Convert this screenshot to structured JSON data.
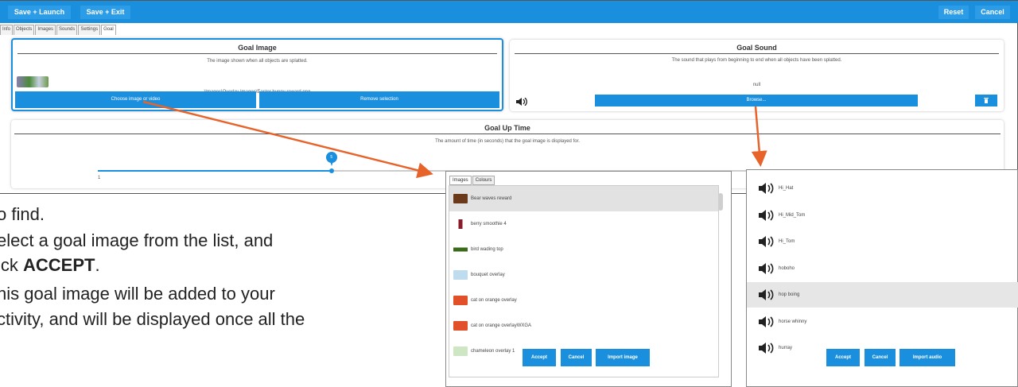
{
  "toolbar": {
    "save_launch": "Save + Launch",
    "save_exit": "Save + Exit",
    "reset": "Reset",
    "cancel": "Cancel"
  },
  "tabs": [
    "Info",
    "Objects",
    "Images",
    "Sounds",
    "Settings",
    "Goal"
  ],
  "goal_image": {
    "title": "Goal Image",
    "desc": "The image shown when all objects are splatted.",
    "path": "\\Images\\Overlay Images\\Easter bunny reward.png",
    "choose_btn": "Choose image or video",
    "remove_btn": "Remove selection"
  },
  "goal_sound": {
    "title": "Goal Sound",
    "desc": "The sound that plays from beginning to end when all objects have been splatted.",
    "value": "null",
    "browse_btn": "Browse..."
  },
  "goal_up": {
    "title": "Goal Up Time",
    "desc": "The amount of time (in seconds) that the goal image is displayed for.",
    "slider_value": "5",
    "slider_min": "1",
    "slider_fraction": 0.26
  },
  "image_picker": {
    "tabs": [
      "Images",
      "Colours"
    ],
    "items": [
      "Bear waves reward",
      "berry smoothie 4",
      "bird wading top",
      "bouquet overlay",
      "cat on orange overlay",
      "cat on orange overlayWXGA",
      "chameleon overlay 1"
    ],
    "accept": "Accept",
    "cancel": "Cancel",
    "import": "Import image"
  },
  "sound_picker": {
    "items": [
      "Hi_Hat",
      "Hi_Mid_Tom",
      "Hi_Tom",
      "hoboho",
      "hop boing",
      "horse whinny",
      "hurray"
    ],
    "selected": "hop boing",
    "accept": "Accept",
    "cancel": "Cancel",
    "import": "Import audio"
  },
  "doc_text": {
    "line1": "o find.",
    "line2": "elect a goal image from the list, and",
    "line3_pre": "ick ",
    "line3_bold": "ACCEPT",
    "line3_post": ".",
    "line4": "his goal image will be added to your",
    "line5": "ctivity, and will be displayed once all the"
  },
  "colors": {
    "accent": "#1a8fdd",
    "arrow": "#e8632a"
  }
}
